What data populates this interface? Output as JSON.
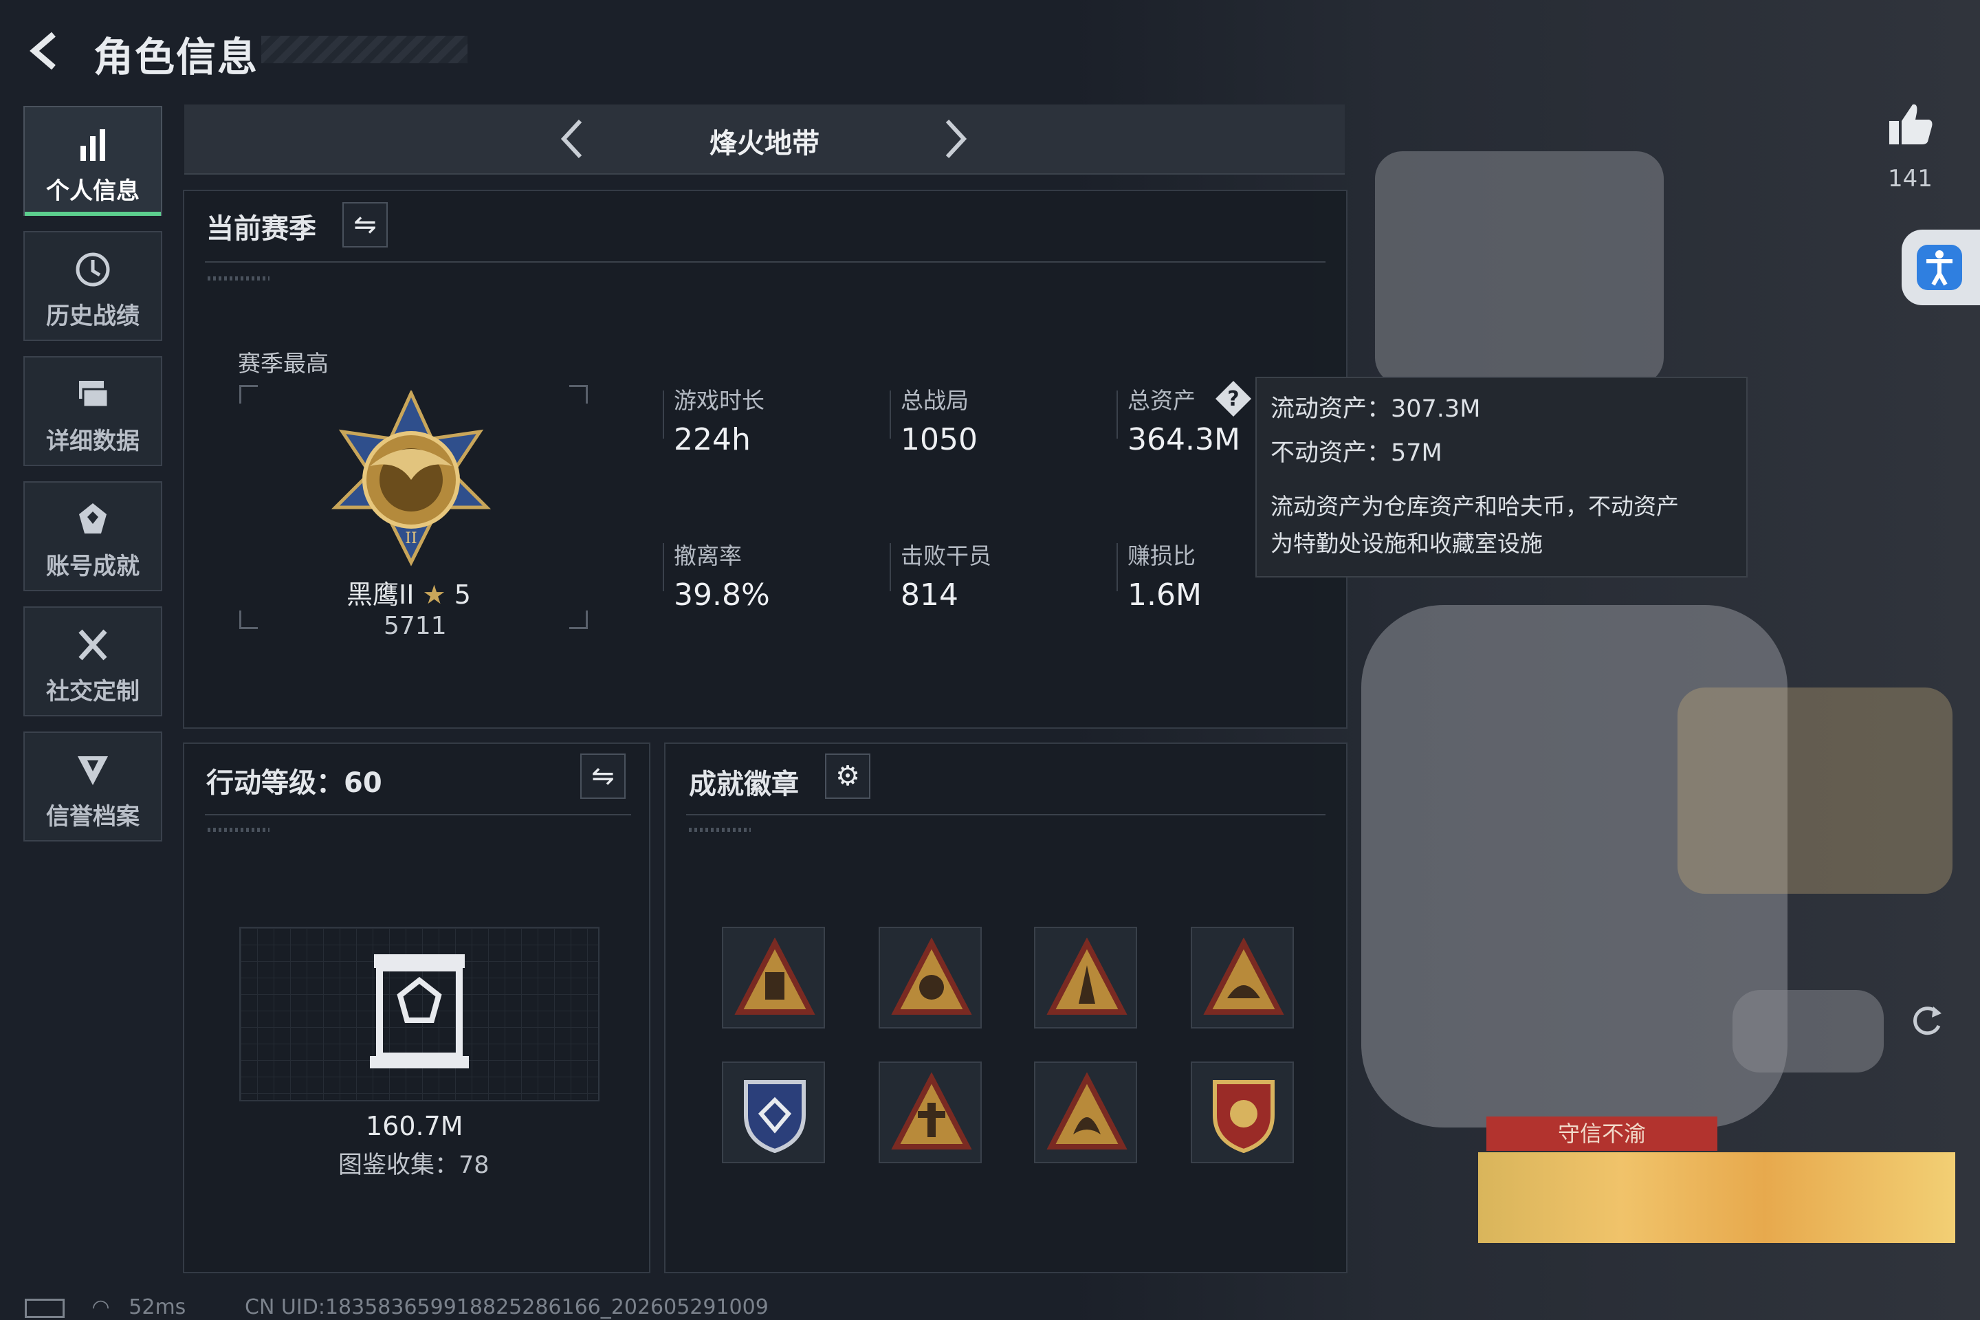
{
  "header": {
    "title": "角色信息"
  },
  "sidebar": {
    "items": [
      {
        "label": "个人信息",
        "icon": "bar-chart-icon",
        "active": true
      },
      {
        "label": "历史战绩",
        "icon": "clock-history-icon",
        "active": false
      },
      {
        "label": "详细数据",
        "icon": "folder-stack-icon",
        "active": false
      },
      {
        "label": "账号成就",
        "icon": "achievement-icon",
        "active": false
      },
      {
        "label": "社交定制",
        "icon": "tools-icon",
        "active": false
      },
      {
        "label": "信誉档案",
        "icon": "credit-shield-icon",
        "active": false
      }
    ]
  },
  "mode_bar": {
    "title": "烽火地带"
  },
  "season": {
    "title": "当前赛季",
    "best_label": "赛季最高",
    "rank_name": "黑鹰II",
    "rank_stars": "5",
    "rank_points": "5711",
    "stats": [
      {
        "label": "游戏时长",
        "value": "224h"
      },
      {
        "label": "总战局",
        "value": "1050"
      },
      {
        "label": "总资产",
        "value": "364.3M"
      },
      {
        "label": "撤离率",
        "value": "39.8%"
      },
      {
        "label": "击败干员",
        "value": "814"
      },
      {
        "label": "赚损比",
        "value": "1.6M"
      }
    ]
  },
  "tooltip": {
    "liquid": "流动资产：307.3M",
    "fixed": "不动资产：57M",
    "desc_line1": "流动资产为仓库资产和哈夫币，不动资产",
    "desc_line2": "为特勤处设施和收藏室设施"
  },
  "action_level": {
    "title": "行动等级：60",
    "value": "160.7M",
    "collection": "图鉴收集：78"
  },
  "achievements": {
    "title": "成就徽章",
    "badges": [
      "badge-1",
      "badge-2",
      "badge-3",
      "badge-4",
      "badge-5",
      "badge-6",
      "badge-7",
      "badge-8"
    ]
  },
  "right": {
    "like_count": "141",
    "card_title": "守信不渝"
  },
  "status": {
    "ping": "52ms",
    "uid": "CN UID:18358365991882528616​6_202605291009"
  },
  "colors": {
    "accent_green": "#5ccf8e",
    "tooltip_bg": "#23282f",
    "card_red": "#b2332e"
  }
}
